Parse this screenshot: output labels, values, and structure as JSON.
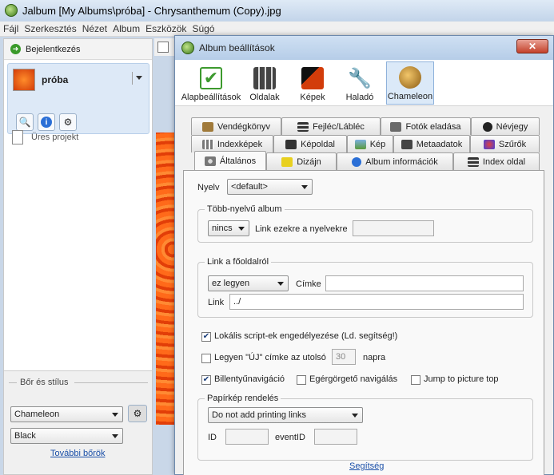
{
  "window": {
    "title": "Jalbum [My Albums\\próba] - Chrysanthemum (Copy).jpg"
  },
  "menu": [
    "Fájl",
    "Szerkesztés",
    "Nézet",
    "Album",
    "Eszközök",
    "Súgó"
  ],
  "left": {
    "login": "Bejelentkezés",
    "project_name": "próba",
    "empty_project": "Üres projekt",
    "skin_section": "Bőr és stílus",
    "skin": "Chameleon",
    "style": "Black",
    "more_skins": "További bőrök"
  },
  "dialog": {
    "title": "Album beállítások",
    "toolbar": [
      {
        "label": "Alapbeállítások",
        "icon": "checkmark-icon",
        "color": "#3d9a2e"
      },
      {
        "label": "Oldalak",
        "icon": "pages-icon",
        "color": "#555555"
      },
      {
        "label": "Képek",
        "icon": "images-icon",
        "color": "#d23c0a"
      },
      {
        "label": "Haladó",
        "icon": "wrench-icon",
        "color": "#8a8a8a"
      },
      {
        "label": "Chameleon",
        "icon": "chameleon-icon",
        "color": "#c8962e"
      }
    ],
    "tabs_row1": [
      "Vendégkönyv",
      "Fejléc/Lábléc",
      "Fotók eladása",
      "Névjegy"
    ],
    "tabs_row2": [
      "Indexképek",
      "Képoldal",
      "Kép",
      "Metaadatok",
      "Szűrők"
    ],
    "tabs_row3": [
      "Általános",
      "Dizájn",
      "Album információk",
      "Index oldal"
    ],
    "general": {
      "language_label": "Nyelv",
      "language_value": "<default>",
      "multilang_legend": "Több-nyelvű album",
      "multilang_value": "nincs",
      "multilang_link_label": "Link ezekre a nyelvekre",
      "home_legend": "Link a főoldalról",
      "home_combo": "ez legyen",
      "label_label": "Címke",
      "link_label": "Link",
      "link_value": "../",
      "local_scripts": "Lokális script-ek engedélyezése (Ld. segítség!)",
      "new_label_prefix": "Legyen \"ÚJ\" címke az utolsó",
      "new_days": "30",
      "new_label_suffix": "napra",
      "keyboard_nav": "Billentyűnavigáció",
      "mouse_wheel": "Egérgörgető navigálás",
      "jump_top": "Jump to picture top",
      "print_legend": "Papírkép rendelés",
      "print_value": "Do not add printing links",
      "id_label": "ID",
      "event_label": "eventID",
      "help_link": "Segítség"
    }
  }
}
